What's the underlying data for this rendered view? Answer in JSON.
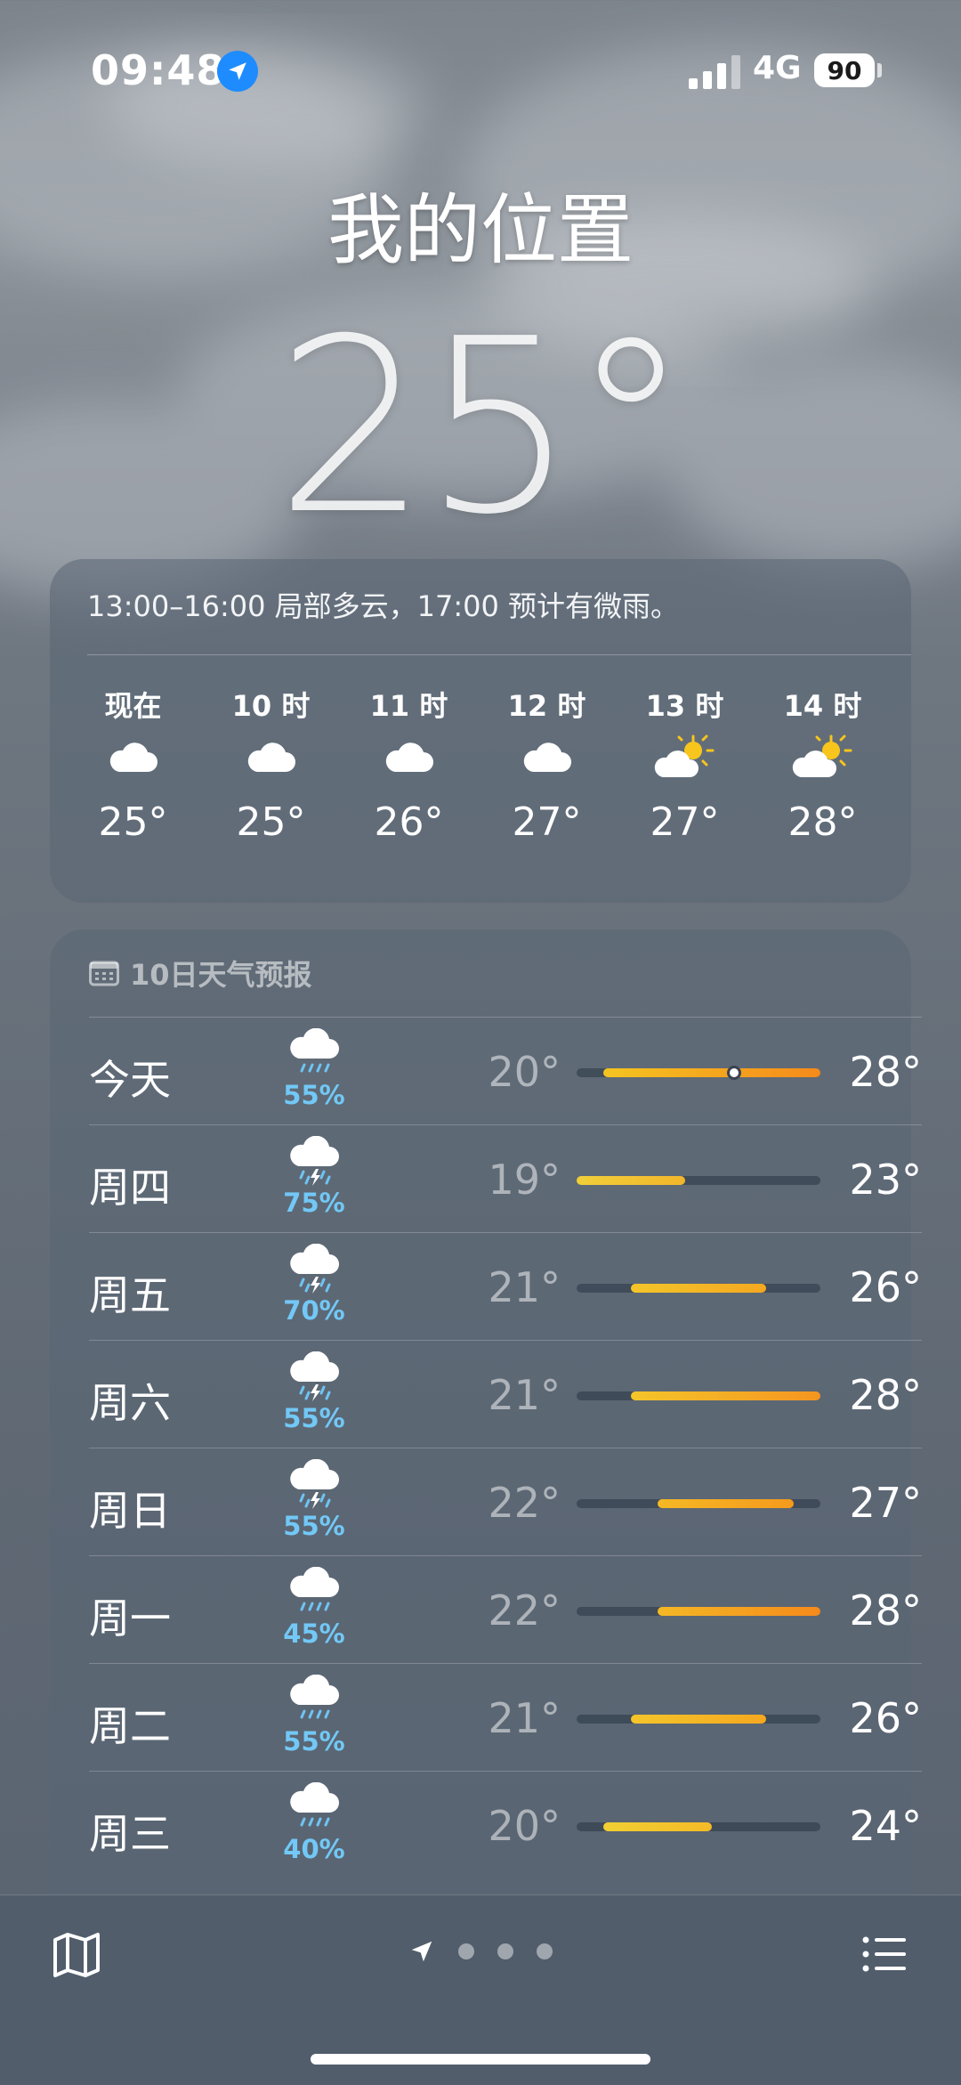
{
  "status_bar": {
    "time": "09:48",
    "network": "4G",
    "battery": "90"
  },
  "location": {
    "city": "我的位置",
    "temperature": "25°"
  },
  "hourly_card": {
    "summary": "13:00–16:00 局部多云，17:00 预计有微雨。",
    "hours": [
      {
        "label": "现在",
        "icon": "cloud-icon",
        "temp": "25°"
      },
      {
        "label": "10 时",
        "icon": "cloud-icon",
        "temp": "25°"
      },
      {
        "label": "11 时",
        "icon": "cloud-icon",
        "temp": "26°"
      },
      {
        "label": "12 时",
        "icon": "cloud-icon",
        "temp": "27°"
      },
      {
        "label": "13 时",
        "icon": "partly-sunny-icon",
        "temp": "27°"
      },
      {
        "label": "14 时",
        "icon": "partly-sunny-icon",
        "temp": "28°"
      }
    ]
  },
  "forecast": {
    "title": "10日天气预报",
    "range_min": 19,
    "range_max": 28,
    "days": [
      {
        "day": "今天",
        "icon": "rain-cloud-icon",
        "pop": "55%",
        "low": "20°",
        "high": "28°",
        "low_val": 20,
        "high_val": 28,
        "current_val": 24.8,
        "colors": [
          "#f5c421",
          "#f58a1b"
        ]
      },
      {
        "day": "周四",
        "icon": "thunder-rain-icon",
        "pop": "75%",
        "low": "19°",
        "high": "23°",
        "low_val": 19,
        "high_val": 23,
        "colors": [
          "#f0cf3a",
          "#f2b62b"
        ]
      },
      {
        "day": "周五",
        "icon": "thunder-rain-icon",
        "pop": "70%",
        "low": "21°",
        "high": "26°",
        "low_val": 21,
        "high_val": 26,
        "colors": [
          "#f4c52a",
          "#f5a820"
        ]
      },
      {
        "day": "周六",
        "icon": "thunder-rain-icon",
        "pop": "55%",
        "low": "21°",
        "high": "28°",
        "low_val": 21,
        "high_val": 28,
        "colors": [
          "#f4c52a",
          "#f59520"
        ]
      },
      {
        "day": "周日",
        "icon": "thunder-rain-icon",
        "pop": "55%",
        "low": "22°",
        "high": "27°",
        "low_val": 22,
        "high_val": 27,
        "colors": [
          "#f5b825",
          "#f59a1c"
        ]
      },
      {
        "day": "周一",
        "icon": "rain-cloud-icon",
        "pop": "45%",
        "low": "22°",
        "high": "28°",
        "low_val": 22,
        "high_val": 28,
        "colors": [
          "#f5b825",
          "#f58a1b"
        ]
      },
      {
        "day": "周二",
        "icon": "rain-cloud-icon",
        "pop": "55%",
        "low": "21°",
        "high": "26°",
        "low_val": 21,
        "high_val": 26,
        "colors": [
          "#f4c52a",
          "#f5a820"
        ]
      },
      {
        "day": "周三",
        "icon": "rain-cloud-icon",
        "pop": "40%",
        "low": "20°",
        "high": "24°",
        "low_val": 20,
        "high_val": 24,
        "colors": [
          "#f1cf33",
          "#f4bb27"
        ]
      }
    ]
  },
  "tab_bar": {
    "map_icon": "map-icon",
    "location_icon": "location-arrow-icon",
    "list_icon": "list-icon",
    "page_count": 3
  }
}
